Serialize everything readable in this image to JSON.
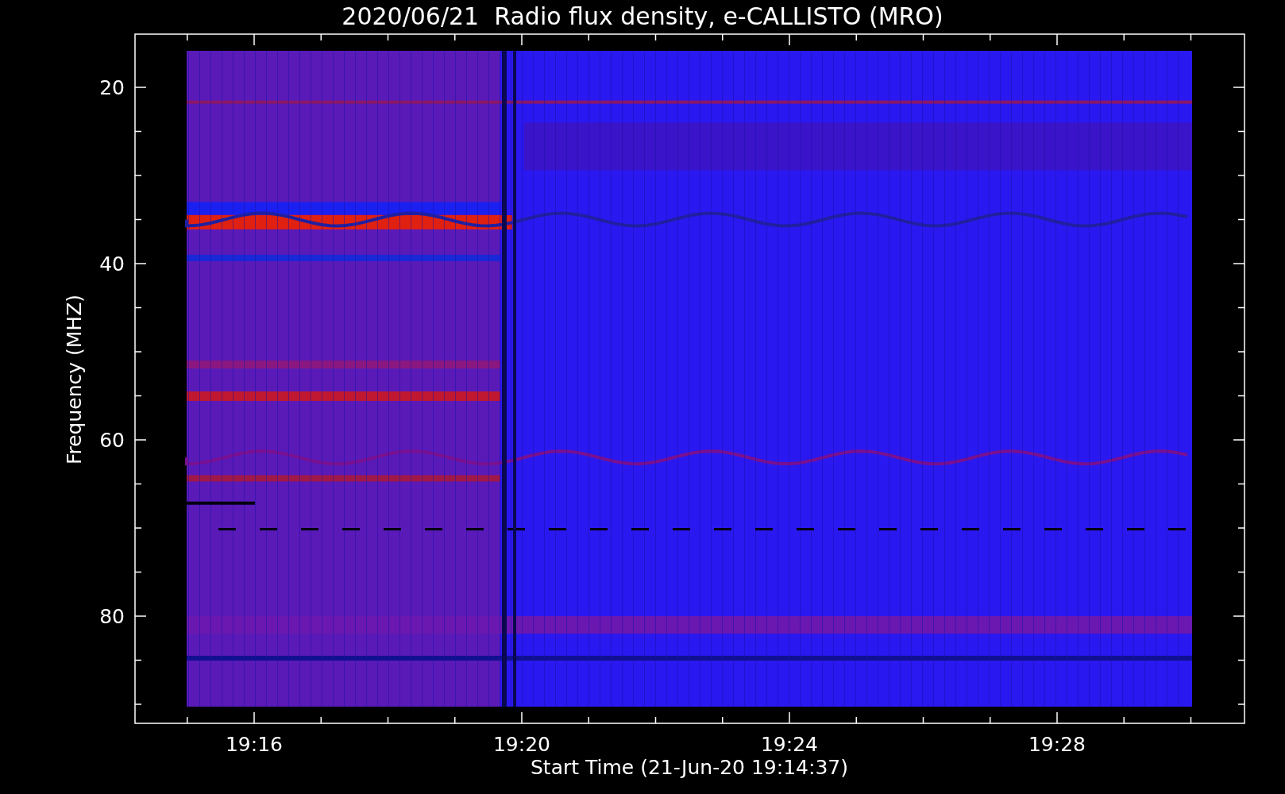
{
  "title": "2020/06/21  Radio flux density, e-CALLISTO (MRO)",
  "y_axis": {
    "label": "Frequency (MHZ)",
    "ticks": [
      "20",
      "40",
      "60",
      "80"
    ]
  },
  "x_axis": {
    "label": "Start Time (21-Jun-20 19:14:37)",
    "ticks": [
      "19:16",
      "19:20",
      "19:24",
      "19:28"
    ]
  }
}
